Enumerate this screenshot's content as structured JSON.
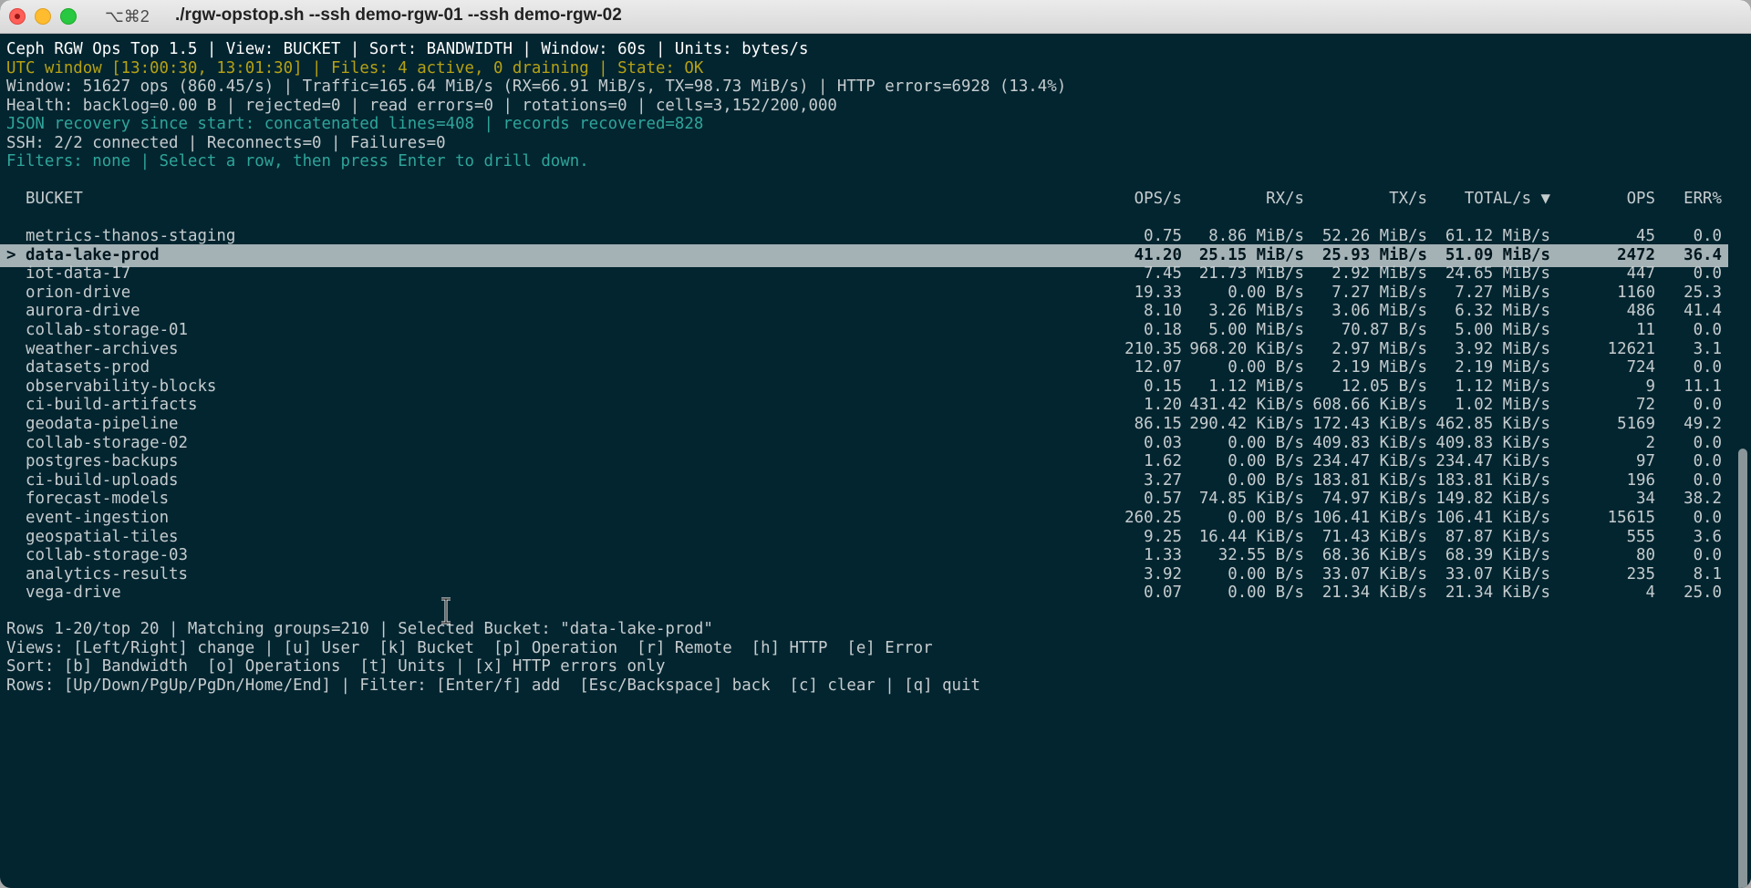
{
  "window": {
    "shortcut": "⌥⌘2",
    "title": "./rgw-opstop.sh --ssh demo-rgw-01 --ssh demo-rgw-02"
  },
  "status": {
    "line1": "Ceph RGW Ops Top 1.5 | View: BUCKET | Sort: BANDWIDTH | Window: 60s | Units: bytes/s",
    "line2": "UTC window [13:00:30, 13:01:30] | Files: 4 active, 0 draining | State: OK",
    "line3": "Window: 51627 ops (860.45/s) | Traffic=165.64 MiB/s (RX=66.91 MiB/s, TX=98.73 MiB/s) | HTTP errors=6928 (13.4%)",
    "line4": "Health: backlog=0.00 B | rejected=0 | read errors=0 | rotations=0 | cells=3,152/200,000",
    "line5": "JSON recovery since start: concatenated lines=408 | records recovered=828",
    "line6": "SSH: 2/2 connected | Reconnects=0 | Failures=0",
    "line7": "Filters: none | Select a row, then press Enter to drill down."
  },
  "columns": {
    "bucket": "BUCKET",
    "ops_s": "OPS/s",
    "rx_s": "RX/s",
    "tx_s": "TX/s",
    "total_s": "TOTAL/s ▼",
    "ops": "OPS",
    "err": "ERR%"
  },
  "selected_marker": ">",
  "rows": [
    {
      "bucket": "metrics-thanos-staging",
      "ops_s": "0.75",
      "rx": "8.86 MiB/s",
      "tx": "52.26 MiB/s",
      "total": "61.12 MiB/s",
      "ops": "45",
      "err": "0.0"
    },
    {
      "bucket": "data-lake-prod",
      "ops_s": "41.20",
      "rx": "25.15 MiB/s",
      "tx": "25.93 MiB/s",
      "total": "51.09 MiB/s",
      "ops": "2472",
      "err": "36.4"
    },
    {
      "bucket": "iot-data-17",
      "ops_s": "7.45",
      "rx": "21.73 MiB/s",
      "tx": "2.92 MiB/s",
      "total": "24.65 MiB/s",
      "ops": "447",
      "err": "0.0"
    },
    {
      "bucket": "orion-drive",
      "ops_s": "19.33",
      "rx": "0.00 B/s",
      "tx": "7.27 MiB/s",
      "total": "7.27 MiB/s",
      "ops": "1160",
      "err": "25.3"
    },
    {
      "bucket": "aurora-drive",
      "ops_s": "8.10",
      "rx": "3.26 MiB/s",
      "tx": "3.06 MiB/s",
      "total": "6.32 MiB/s",
      "ops": "486",
      "err": "41.4"
    },
    {
      "bucket": "collab-storage-01",
      "ops_s": "0.18",
      "rx": "5.00 MiB/s",
      "tx": "70.87 B/s",
      "total": "5.00 MiB/s",
      "ops": "11",
      "err": "0.0"
    },
    {
      "bucket": "weather-archives",
      "ops_s": "210.35",
      "rx": "968.20 KiB/s",
      "tx": "2.97 MiB/s",
      "total": "3.92 MiB/s",
      "ops": "12621",
      "err": "3.1"
    },
    {
      "bucket": "datasets-prod",
      "ops_s": "12.07",
      "rx": "0.00 B/s",
      "tx": "2.19 MiB/s",
      "total": "2.19 MiB/s",
      "ops": "724",
      "err": "0.0"
    },
    {
      "bucket": "observability-blocks",
      "ops_s": "0.15",
      "rx": "1.12 MiB/s",
      "tx": "12.05 B/s",
      "total": "1.12 MiB/s",
      "ops": "9",
      "err": "11.1"
    },
    {
      "bucket": "ci-build-artifacts",
      "ops_s": "1.20",
      "rx": "431.42 KiB/s",
      "tx": "608.66 KiB/s",
      "total": "1.02 MiB/s",
      "ops": "72",
      "err": "0.0"
    },
    {
      "bucket": "geodata-pipeline",
      "ops_s": "86.15",
      "rx": "290.42 KiB/s",
      "tx": "172.43 KiB/s",
      "total": "462.85 KiB/s",
      "ops": "5169",
      "err": "49.2"
    },
    {
      "bucket": "collab-storage-02",
      "ops_s": "0.03",
      "rx": "0.00 B/s",
      "tx": "409.83 KiB/s",
      "total": "409.83 KiB/s",
      "ops": "2",
      "err": "0.0"
    },
    {
      "bucket": "postgres-backups",
      "ops_s": "1.62",
      "rx": "0.00 B/s",
      "tx": "234.47 KiB/s",
      "total": "234.47 KiB/s",
      "ops": "97",
      "err": "0.0"
    },
    {
      "bucket": "ci-build-uploads",
      "ops_s": "3.27",
      "rx": "0.00 B/s",
      "tx": "183.81 KiB/s",
      "total": "183.81 KiB/s",
      "ops": "196",
      "err": "0.0"
    },
    {
      "bucket": "forecast-models",
      "ops_s": "0.57",
      "rx": "74.85 KiB/s",
      "tx": "74.97 KiB/s",
      "total": "149.82 KiB/s",
      "ops": "34",
      "err": "38.2"
    },
    {
      "bucket": "event-ingestion",
      "ops_s": "260.25",
      "rx": "0.00 B/s",
      "tx": "106.41 KiB/s",
      "total": "106.41 KiB/s",
      "ops": "15615",
      "err": "0.0"
    },
    {
      "bucket": "geospatial-tiles",
      "ops_s": "9.25",
      "rx": "16.44 KiB/s",
      "tx": "71.43 KiB/s",
      "total": "87.87 KiB/s",
      "ops": "555",
      "err": "3.6"
    },
    {
      "bucket": "collab-storage-03",
      "ops_s": "1.33",
      "rx": "32.55 B/s",
      "tx": "68.36 KiB/s",
      "total": "68.39 KiB/s",
      "ops": "80",
      "err": "0.0"
    },
    {
      "bucket": "analytics-results",
      "ops_s": "3.92",
      "rx": "0.00 B/s",
      "tx": "33.07 KiB/s",
      "total": "33.07 KiB/s",
      "ops": "235",
      "err": "8.1"
    },
    {
      "bucket": "vega-drive",
      "ops_s": "0.07",
      "rx": "0.00 B/s",
      "tx": "21.34 KiB/s",
      "total": "21.34 KiB/s",
      "ops": "4",
      "err": "25.0"
    }
  ],
  "footer": {
    "line1": "Rows 1-20/top 20 | Matching groups=210 | Selected Bucket: \"data-lake-prod\"",
    "line2": "Views: [Left/Right] change | [u] User  [k] Bucket  [p] Operation  [r] Remote  [h] HTTP  [e] Error",
    "line3": "Sort: [b] Bandwidth  [o] Operations  [t] Units | [x] HTTP errors only",
    "line4": "Rows: [Up/Down/PgUp/PgDn/Home/End] | Filter: [Enter/f] add  [Esc/Backspace] back  [c] clear | [q] quit"
  },
  "colors": {
    "background": "#032530",
    "yellow": "#b5a114",
    "green": "#2fa59a",
    "selected_row": "#a4b2b6"
  }
}
